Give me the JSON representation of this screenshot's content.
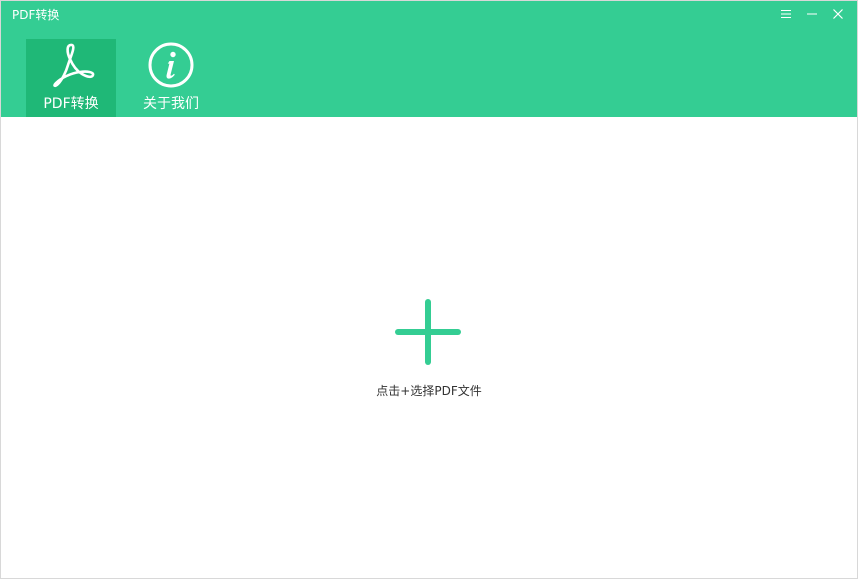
{
  "app": {
    "title": "PDF转换"
  },
  "window_controls": [
    {
      "name": "menu-icon"
    },
    {
      "name": "minimize-icon"
    },
    {
      "name": "close-icon"
    }
  ],
  "tabs": [
    {
      "label": "PDF转换",
      "icon": "acrobat-pdf-icon",
      "active": true
    },
    {
      "label": "关于我们",
      "icon": "info-icon",
      "active": false
    }
  ],
  "main": {
    "add_icon": "plus-icon",
    "add_label": "点击+选择PDF文件"
  },
  "colors": {
    "brand": "#34cd93",
    "active_tab": "#1fb877",
    "background": "#ffffff",
    "text": "#333333"
  }
}
